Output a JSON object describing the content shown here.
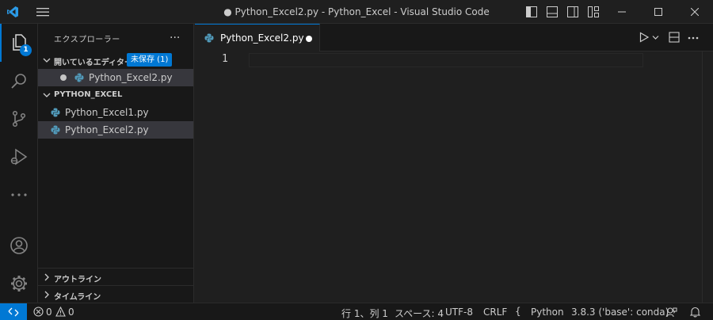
{
  "window": {
    "title": "● Python_Excel2.py - Python_Excel - Visual Studio Code"
  },
  "activity_bar": {
    "explorer_badge": "1"
  },
  "sidebar": {
    "header": "エクスプローラー",
    "more": "···",
    "open_editors": {
      "label": "開いているエディター",
      "badge": "未保存 (1)",
      "items": [
        {
          "name": "Python_Excel2.py"
        }
      ]
    },
    "folder": {
      "label": "PYTHON_EXCEL",
      "files": [
        {
          "name": "Python_Excel1.py"
        },
        {
          "name": "Python_Excel2.py"
        }
      ]
    },
    "outline_label": "アウトライン",
    "timeline_label": "タイムライン"
  },
  "editor": {
    "tab_name": "Python_Excel2.py",
    "line_number": "1"
  },
  "status_bar": {
    "errors": "0",
    "warnings": "0",
    "position": "行 1、列 1",
    "spaces": "スペース: 4",
    "encoding": "UTF-8",
    "eol": "CRLF",
    "language": "Python",
    "interpreter": "3.8.3 ('base': conda)"
  },
  "colors": {
    "accent": "#0078d4",
    "python_icon": "#519aba",
    "background": "#1f1f1f",
    "sidebar": "#181818"
  }
}
